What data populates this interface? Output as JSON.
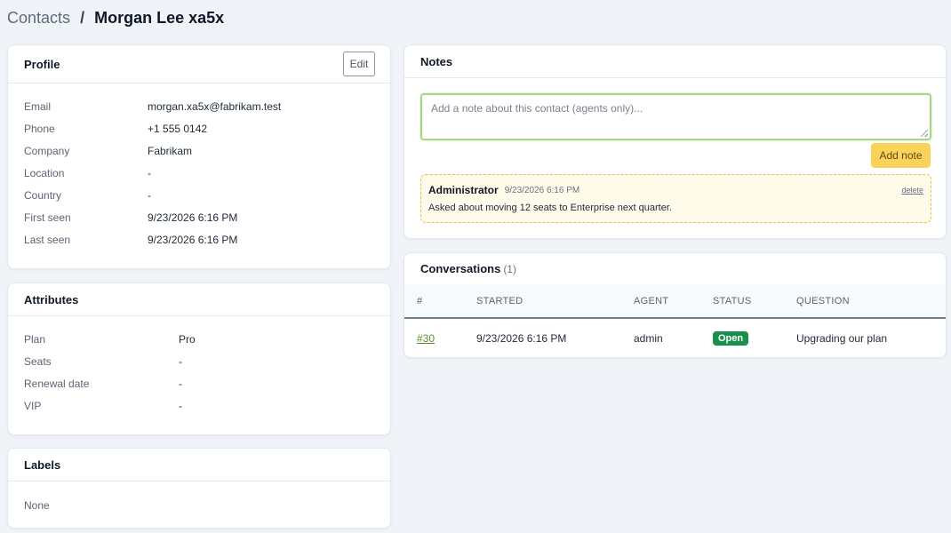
{
  "breadcrumb": {
    "parent": "Contacts",
    "separator": "/",
    "current": "Morgan Lee xa5x"
  },
  "profile": {
    "title": "Profile",
    "edit_label": "Edit",
    "fields": [
      {
        "label": "Email",
        "value": "morgan.xa5x@fabrikam.test"
      },
      {
        "label": "Phone",
        "value": "+1 555 0142"
      },
      {
        "label": "Company",
        "value": "Fabrikam"
      },
      {
        "label": "Location",
        "value": "-"
      },
      {
        "label": "Country",
        "value": "-"
      },
      {
        "label": "First seen",
        "value": "9/23/2026 6:16 PM"
      },
      {
        "label": "Last seen",
        "value": "9/23/2026 6:16 PM"
      }
    ]
  },
  "attributes": {
    "title": "Attributes",
    "fields": [
      {
        "label": "Plan",
        "value": "Pro"
      },
      {
        "label": "Seats",
        "value": "-"
      },
      {
        "label": "Renewal date",
        "value": "-"
      },
      {
        "label": "VIP",
        "value": "-"
      }
    ]
  },
  "labels": {
    "title": "Labels",
    "empty_text": "None"
  },
  "notes": {
    "title": "Notes",
    "input_value": "",
    "input_placeholder": "Add a note about this contact (agents only)...",
    "add_label": "Add note",
    "items": [
      {
        "author": "Administrator",
        "time": "9/23/2026 6:16 PM",
        "delete_label": "delete",
        "text": "Asked about moving 12 seats to Enterprise next quarter."
      }
    ]
  },
  "conversations": {
    "title": "Conversations",
    "count": "(1)",
    "columns": [
      "#",
      "STARTED",
      "AGENT",
      "STATUS",
      "QUESTION"
    ],
    "rows": [
      {
        "id": "#30",
        "started": "9/23/2026 6:16 PM",
        "agent": "admin",
        "status": "Open",
        "question": "Upgrading our plan"
      }
    ]
  },
  "colors": {
    "accent_green": "#1a8f4b",
    "link_green": "#5e8b2e",
    "add_note_yellow": "#fbd35a",
    "note_bg": "#fffbea"
  }
}
